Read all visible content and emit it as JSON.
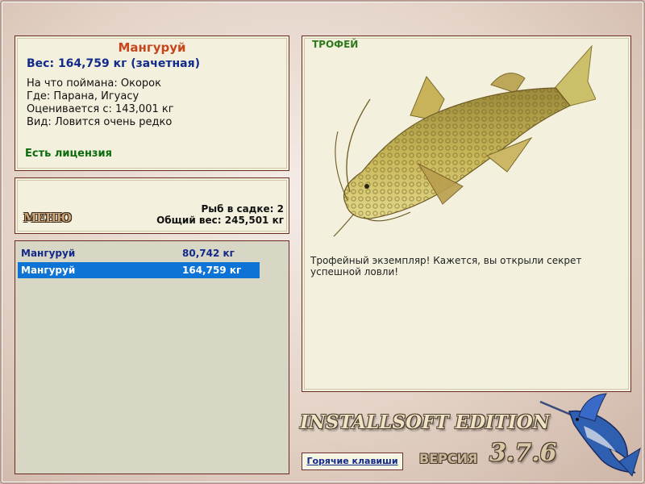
{
  "fish_info": {
    "title": "Мангуруй",
    "weight": "Вес: 164,759 кг (зачетная)",
    "bait": "На что поймана: Окорок",
    "location": "Где: Парана, Игуасу",
    "valued_from": "Оценивается с: 143,001 кг",
    "rarity": "Вид: Ловится очень редко",
    "license": "Есть лицензия"
  },
  "menu_panel": {
    "menu_label": "МЕНЮ",
    "fish_count": "Рыб в садке: 2",
    "total_weight": "Общий вес: 245,501 кг"
  },
  "catch_list": {
    "rows": [
      {
        "name": "Мангуруй",
        "weight": "80,742 кг",
        "selected": false
      },
      {
        "name": "Мангуруй",
        "weight": "164,759 кг",
        "selected": true
      }
    ],
    "selected_bg": "#0d74d6",
    "text_color": "#122a8a"
  },
  "trophy": {
    "label": "ТРОФЕЙ",
    "description": "Трофейный экземпляр! Кажется, вы открыли секрет успешной ловли!"
  },
  "footer": {
    "brand": "INSTALLSOFT EDITION",
    "version_label": "ВЕРСИЯ",
    "version_number": "3.7.6",
    "hotkeys": "Горячие клавиши"
  },
  "icons": {
    "fish_image": "catfish-image",
    "logo_image": "marlin-logo"
  }
}
